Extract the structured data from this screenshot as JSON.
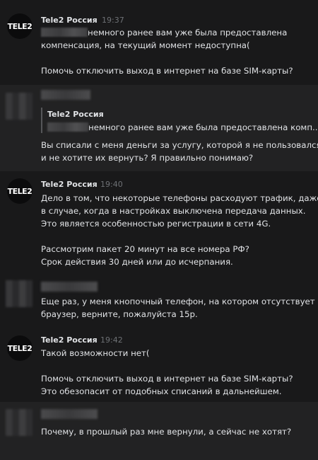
{
  "messages": [
    {
      "sender": "Tele2 Россия",
      "time": "19:37",
      "avatar_text": "TELE2",
      "lines": [
        "немного ранее вам уже была предоставлена",
        "компенсация, на текущий момент недоступна(",
        "",
        "Помочь отключить выход в интернет на базе SIM-карты?"
      ]
    },
    {
      "quote": {
        "sender": "Tele2 Россия",
        "text": "немного ранее вам уже была предоставлена комп..."
      },
      "lines": [
        "Вы списали с меня деньги за услугу, которой я не пользовался",
        "и не хотите их вернуть? Я правильно понимаю?"
      ]
    },
    {
      "sender": "Tele2 Россия",
      "time": "19:40",
      "avatar_text": "TELE2",
      "lines": [
        "Дело в том, что некоторые телефоны расходуют трафик, даже",
        "в случае, когда в настройках выключена передача данных.",
        "Это является особенностью регистрации в сети 4G.",
        "",
        "Рассмотрим пакет 20 минут на все номера РФ?",
        "Срок действия 30 дней или до исчерпания."
      ]
    },
    {
      "lines": [
        "Еще раз, у меня кнопочный телефон, на котором отсутствует",
        "браузер, верните, пожалуйста 15р."
      ]
    },
    {
      "sender": "Tele2 Россия",
      "time": "19:42",
      "avatar_text": "TELE2",
      "lines": [
        "Такой возможности нет(",
        "",
        "Помочь отключить выход в интернет на базе SIM-карты?",
        "Это обезопасит от подобных списаний в дальнейшем."
      ]
    },
    {
      "lines": [
        "Почему, в прошлый раз мне вернули, а сейчас не хотят?"
      ]
    }
  ]
}
